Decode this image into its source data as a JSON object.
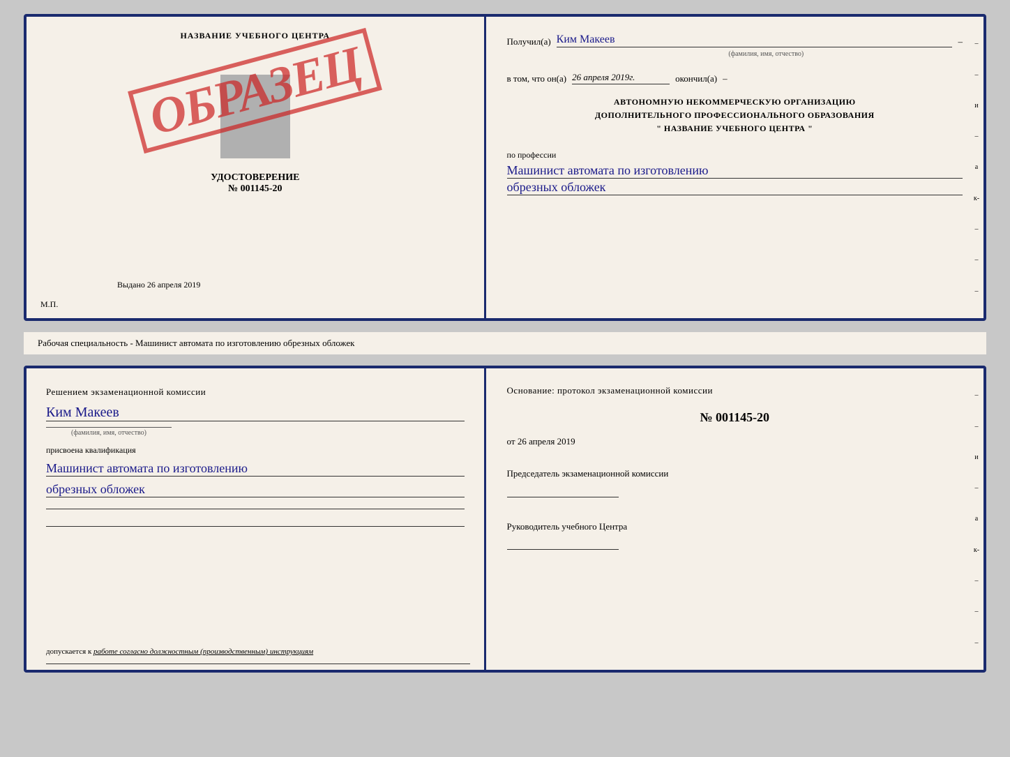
{
  "cert": {
    "left": {
      "title": "НАЗВАНИЕ УЧЕБНОГО ЦЕНТРА",
      "stamp": "ОБРАЗЕЦ",
      "udostoverenie_label": "УДОСТОВЕРЕНИЕ",
      "number": "№ 001145-20",
      "vydano_label": "Выдано",
      "vydano_date": "26 апреля 2019",
      "mp": "М.П."
    },
    "right": {
      "poluchil_label": "Получил(а)",
      "poluchil_name": "Ким Макеев",
      "fio_label": "(фамилия, имя, отчество)",
      "vtom_label": "в том, что он(а)",
      "vtom_date": "26 апреля 2019г.",
      "okonchil_label": "окончил(а)",
      "org_line1": "АВТОНОМНУЮ НЕКОММЕРЧЕСКУЮ ОРГАНИЗАЦИЮ",
      "org_line2": "ДОПОЛНИТЕЛЬНОГО ПРОФЕССИОНАЛЬНОГО ОБРАЗОВАНИЯ",
      "org_line3": "\"   НАЗВАНИЕ УЧЕБНОГО ЦЕНТРА   \"",
      "profession_label": "по профессии",
      "profession_value1": "Машинист автомата по изготовлению",
      "profession_value2": "обрезных обложек"
    }
  },
  "subtitle": "Рабочая специальность - Машинист автомата по изготовлению обрезных обложек",
  "qual": {
    "left": {
      "resheniem_label": "Решением экзаменационной комиссии",
      "name": "Ким Макеев",
      "fio_label": "(фамилия, имя, отчество)",
      "prisvoena_label": "присвоена квалификация",
      "profession_value1": "Машинист автомата по изготовлению",
      "profession_value2": "обрезных обложек",
      "dopuskaetsya_label": "допускается к",
      "dopuskaetsya_value": "работе согласно должностным (производственным) инструкциям"
    },
    "right": {
      "osnov_label": "Основание: протокол экзаменационной комиссии",
      "protocol_num": "№  001145-20",
      "ot_label": "от",
      "ot_date": "26 апреля 2019",
      "predsedatel_label": "Председатель экзаменационной комиссии",
      "rukovoditel_label": "Руководитель учебного Центра"
    }
  },
  "side_marks": {
    "top": "и",
    "mid": "а",
    "bot": "к-"
  }
}
